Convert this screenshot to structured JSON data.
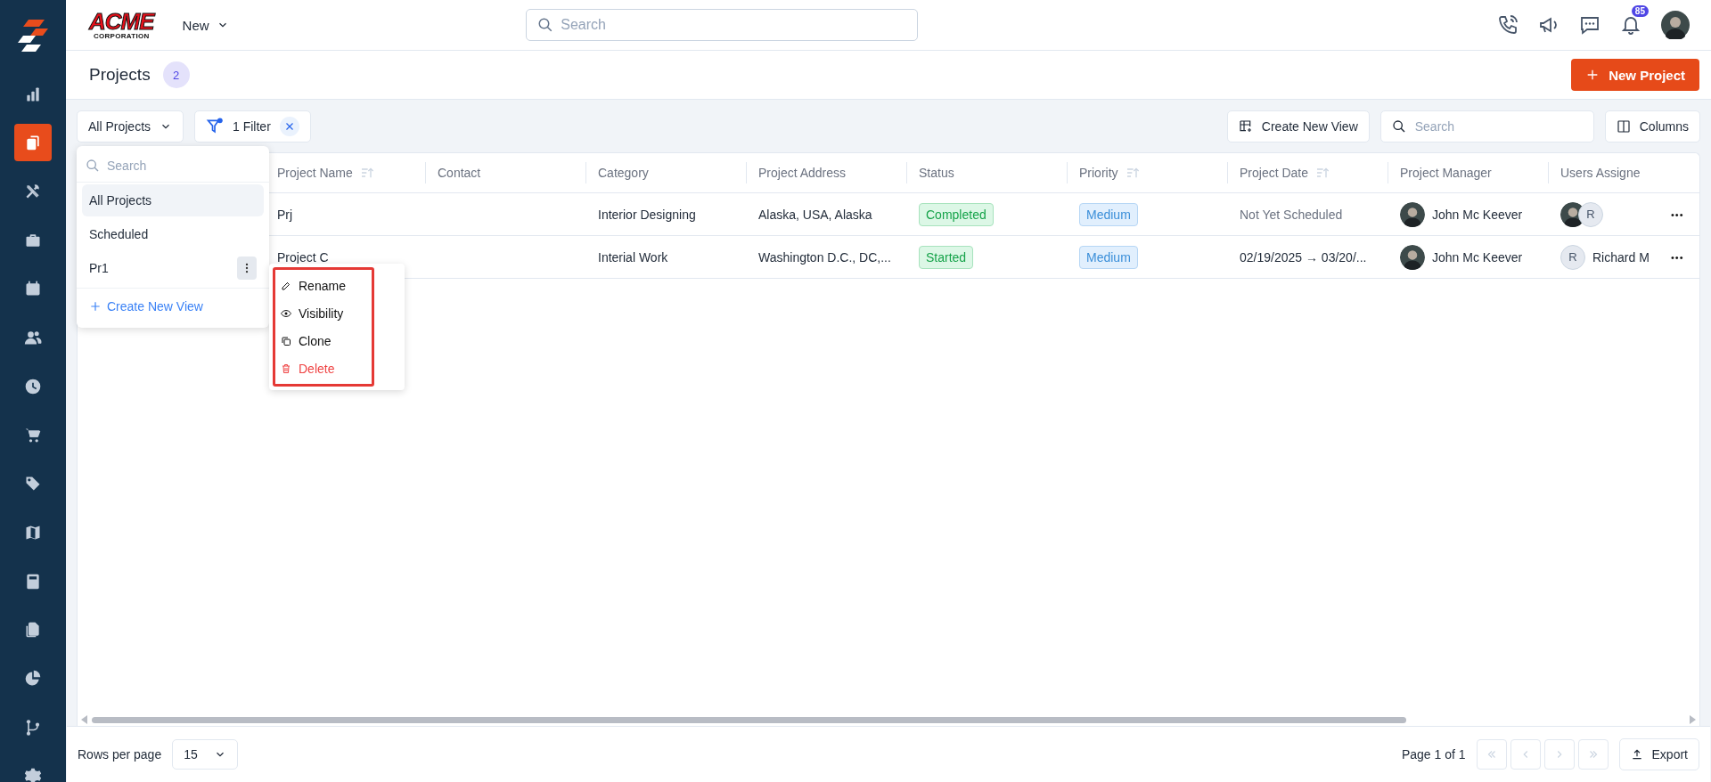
{
  "sidebar": {
    "items": [
      {
        "kind": "chart",
        "selected": false
      },
      {
        "kind": "clipboard",
        "selected": true
      },
      {
        "kind": "tools",
        "selected": false
      },
      {
        "kind": "briefcase",
        "selected": false
      },
      {
        "kind": "calendar",
        "selected": false
      },
      {
        "kind": "users",
        "selected": false
      },
      {
        "kind": "clock",
        "selected": false
      },
      {
        "kind": "cart",
        "selected": false
      },
      {
        "kind": "tag",
        "selected": false
      },
      {
        "kind": "map",
        "selected": false
      },
      {
        "kind": "calculator",
        "selected": false
      },
      {
        "kind": "files",
        "selected": false
      },
      {
        "kind": "pie",
        "selected": false
      },
      {
        "kind": "branch",
        "selected": false
      },
      {
        "kind": "gear",
        "selected": false
      }
    ]
  },
  "header": {
    "logo": {
      "name": "ACME",
      "sub": "CORPORATION"
    },
    "new_menu": "New",
    "search_placeholder": "Search",
    "notification_count": "85"
  },
  "page": {
    "title": "Projects",
    "count": "2",
    "new_button": "New Project"
  },
  "toolbar": {
    "view_select": "All Projects",
    "filter": "1 Filter",
    "create_view": "Create New View",
    "search_placeholder": "Search",
    "columns": "Columns"
  },
  "table": {
    "columns": [
      {
        "label": "Project Name",
        "sortable": true
      },
      {
        "label": "Contact",
        "sortable": false
      },
      {
        "label": "Category",
        "sortable": false
      },
      {
        "label": "Project Address",
        "sortable": false
      },
      {
        "label": "Status",
        "sortable": false
      },
      {
        "label": "Priority",
        "sortable": true
      },
      {
        "label": "Project Date",
        "sortable": true
      },
      {
        "label": "Project Manager",
        "sortable": false
      },
      {
        "label": "Users Assigne",
        "sortable": false
      }
    ],
    "rows": [
      {
        "name": "Prj",
        "category": "Interior Designing",
        "address": "Alaska, USA, Alaska",
        "status": {
          "label": "Completed"
        },
        "priority": "Medium",
        "date": {
          "text": "Not Yet Scheduled",
          "scheduled": false
        },
        "manager": "John Mc Keever",
        "users": [
          {
            "kind": "photo"
          },
          {
            "kind": "initial",
            "text": "R"
          }
        ],
        "more": "•••"
      },
      {
        "name": "Project C",
        "category": "Interial Work",
        "address": "Washington D.C., DC,...",
        "status": {
          "label": "Started"
        },
        "priority": "Medium",
        "date": {
          "text": "02/19/2025 → 03/20/...",
          "scheduled": true
        },
        "manager": "John Mc Keever",
        "users": [
          {
            "kind": "initial",
            "text": "R",
            "name": "Richard M"
          }
        ],
        "more": "•••"
      }
    ]
  },
  "views_dropdown": {
    "search_placeholder": "Search",
    "items": [
      {
        "label": "All Projects",
        "selected": true,
        "menu_open": false
      },
      {
        "label": "Scheduled",
        "selected": false,
        "menu_open": false
      },
      {
        "label": "Pr1",
        "selected": false,
        "menu_open": true
      }
    ],
    "create": "Create New View"
  },
  "context_menu": {
    "items": [
      {
        "label": "Rename",
        "kind": "rename"
      },
      {
        "label": "Visibility",
        "kind": "visibility"
      },
      {
        "label": "Clone",
        "kind": "clone"
      },
      {
        "label": "Delete",
        "kind": "delete"
      }
    ]
  },
  "footer": {
    "rows_per_page_label": "Rows per page",
    "rows_per_page": "15",
    "page_info": "Page 1 of 1",
    "export": "Export"
  }
}
